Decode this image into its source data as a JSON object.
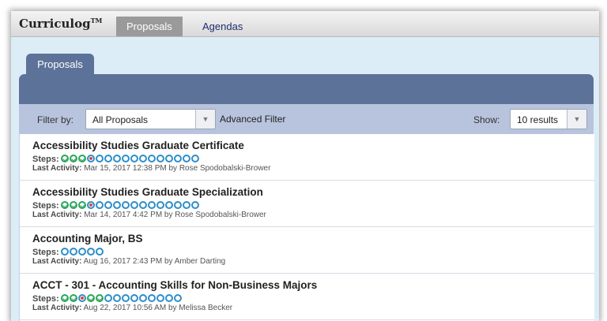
{
  "header": {
    "logo": "Curriculog",
    "logo_tm": "TM",
    "tabs": [
      "Proposals",
      "Agendas"
    ]
  },
  "section_tab": "Proposals",
  "filter": {
    "label": "Filter by:",
    "selected": "All Proposals",
    "advanced_label": "Advanced Filter",
    "show_label": "Show:",
    "show_selected": "10 results"
  },
  "labels": {
    "steps": "Steps:",
    "last_activity": "Last Activity:"
  },
  "proposals": [
    {
      "title": "Accessibility Studies Graduate Certificate",
      "steps": [
        "done",
        "done",
        "done",
        "rejected",
        "pending",
        "pending",
        "pending",
        "pending",
        "pending",
        "pending",
        "pending",
        "pending",
        "pending",
        "pending",
        "pending",
        "pending"
      ],
      "activity": "Mar 15, 2017 12:38 PM by Rose Spodobalski-Brower"
    },
    {
      "title": "Accessibility Studies Graduate Specialization",
      "steps": [
        "done",
        "done",
        "done",
        "rejected",
        "pending",
        "pending",
        "pending",
        "pending",
        "pending",
        "pending",
        "pending",
        "pending",
        "pending",
        "pending",
        "pending",
        "pending"
      ],
      "activity": "Mar 14, 2017 4:42 PM by Rose Spodobalski-Brower"
    },
    {
      "title": "Accounting Major, BS",
      "steps": [
        "pending",
        "pending",
        "pending",
        "pending",
        "pending"
      ],
      "activity": "Aug 16, 2017 2:43 PM by Amber Darting"
    },
    {
      "title": "ACCT - 301 - Accounting Skills for Non-Business Majors",
      "steps": [
        "done",
        "done",
        "rejected",
        "done",
        "done",
        "pending",
        "pending",
        "pending",
        "pending",
        "pending",
        "pending",
        "pending",
        "pending",
        "pending"
      ],
      "activity": "Aug 22, 2017 10:56 AM by Melissa Becker"
    }
  ],
  "colors": {
    "panel": "#5d7299",
    "filter_bar": "#b8c4dd",
    "pending_step": "#2c8ec9",
    "done_step": "#2aa65c",
    "rejected_mark": "#dd3333"
  }
}
